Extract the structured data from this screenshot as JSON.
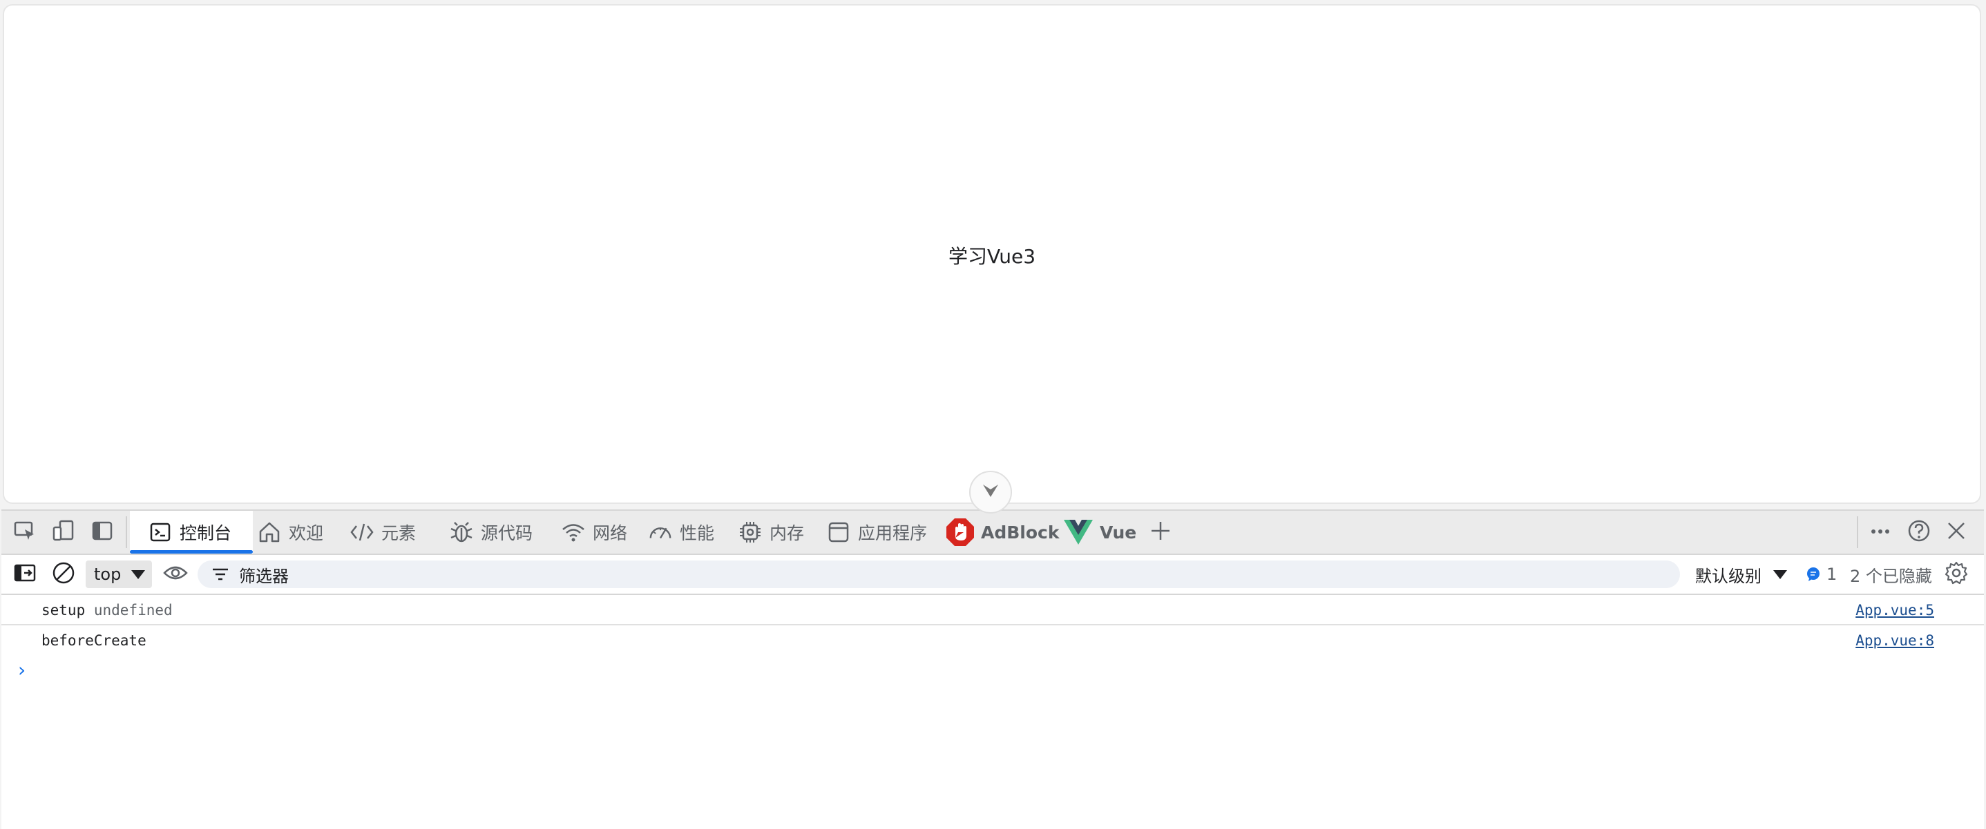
{
  "page": {
    "heading": "学习Vue3"
  },
  "devtools": {
    "tabs": [
      {
        "label": "控制台",
        "icon": "console-icon"
      },
      {
        "label": "欢迎",
        "icon": "home-icon"
      },
      {
        "label": "元素",
        "icon": "code-icon"
      },
      {
        "label": "源代码",
        "icon": "bug-icon"
      },
      {
        "label": "网络",
        "icon": "wifi-icon"
      },
      {
        "label": "性能",
        "icon": "gauge-icon"
      },
      {
        "label": "内存",
        "icon": "chip-icon"
      },
      {
        "label": "应用程序",
        "icon": "window-icon"
      },
      {
        "label": "AdBlock",
        "icon": "adblock-icon"
      },
      {
        "label": "Vue",
        "icon": "vue-icon"
      }
    ],
    "active_tab": "控制台",
    "toolbar": {
      "context": "top",
      "filter_placeholder": "筛选器",
      "level": "默认级别",
      "issues_count": "1",
      "hidden_text": "2 个已隐藏"
    },
    "console": {
      "messages": [
        {
          "keyword": "setup",
          "value": "undefined",
          "source": "App.vue:5"
        },
        {
          "keyword": "beforeCreate",
          "value": "",
          "source": "App.vue:8"
        }
      ],
      "prompt": "›"
    },
    "colors": {
      "accent": "#1a73e8",
      "adblock_red": "#d7261e",
      "vue_green": "#42b883",
      "vue_dark": "#35495e"
    }
  }
}
